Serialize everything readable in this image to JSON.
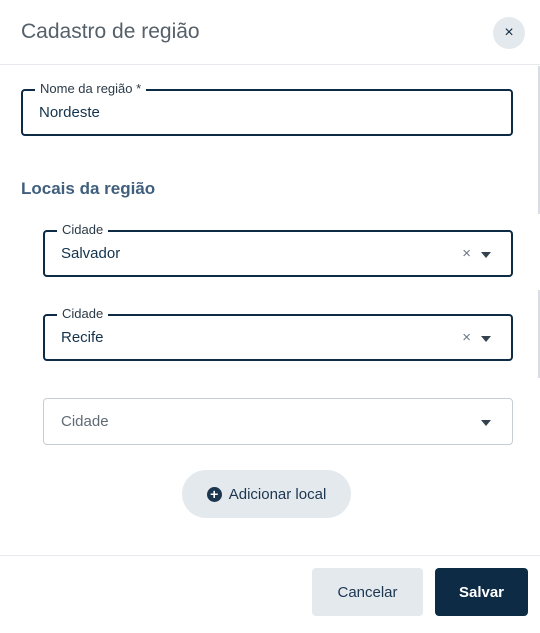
{
  "dialog": {
    "title": "Cadastro de região",
    "close_icon": "×"
  },
  "region_name": {
    "label": "Nome da região *",
    "value": "Nordeste"
  },
  "locations": {
    "title": "Locais da região",
    "items": [
      {
        "label": "Cidade",
        "value": "Salvador",
        "clear_icon": "×"
      },
      {
        "label": "Cidade",
        "value": "Recife",
        "clear_icon": "×"
      }
    ],
    "empty_placeholder": "Cidade",
    "add_label": "Adicionar local",
    "add_icon": "+"
  },
  "footer": {
    "cancel_label": "Cancelar",
    "save_label": "Salvar"
  }
}
